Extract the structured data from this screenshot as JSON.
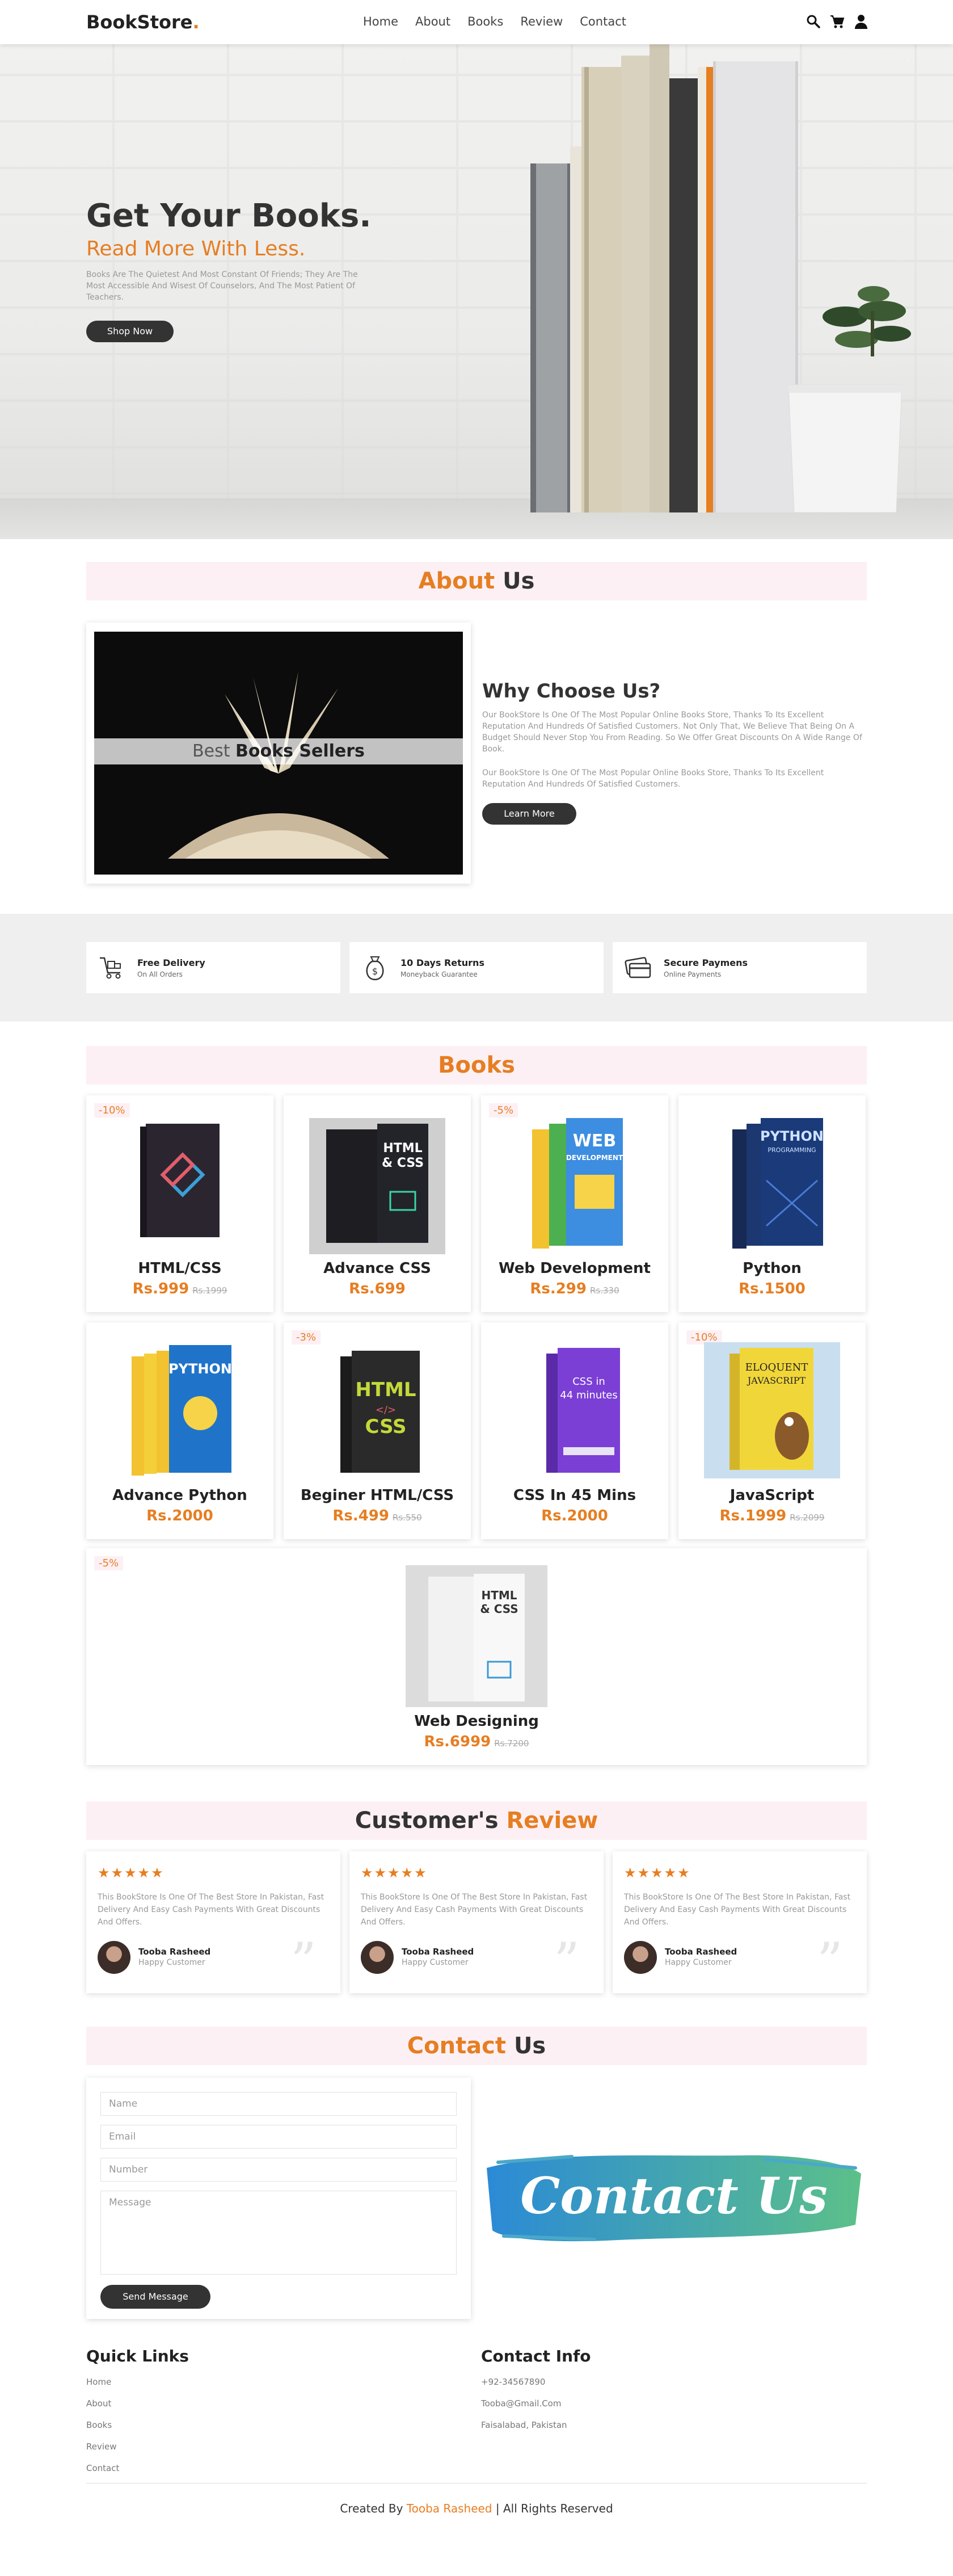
{
  "header": {
    "logo": "BookStore",
    "logo_dot": ".",
    "nav": [
      "Home",
      "About",
      "Books",
      "Review",
      "Contact"
    ],
    "icons": [
      "search-icon",
      "cart-icon",
      "user-icon"
    ]
  },
  "hero": {
    "title": "Get Your Books.",
    "subtitle": "Read More With Less.",
    "text": "Books Are The Quietest And Most Constant Of Friends; They Are The Most Accessible And Wisest Of Counselors, And The Most Patient Of Teachers.",
    "button": "Shop Now"
  },
  "about": {
    "title_accent": "About",
    "title_rest": " Us",
    "image_label_light": "Best ",
    "image_label_bold": "Books Sellers",
    "heading": "Why Choose Us?",
    "para1": "Our BookStore Is One Of The Most Popular Online Books Store, Thanks To Its Excellent Reputation And Hundreds Of Satisfied Customers. Not Only That, We Believe That Being On A Budget Should Never Stop You From Reading. So We Offer Great Discounts On A Wide Range Of Book.",
    "para2": "Our BookStore Is One Of The Most Popular Online Books Store, Thanks To Its Excellent Reputation And Hundreds Of Satisfied Customers.",
    "button": "Learn More"
  },
  "features": [
    {
      "icon": "delivery-cart-icon",
      "title": "Free Delivery",
      "sub": "On All Orders"
    },
    {
      "icon": "money-bag-icon",
      "title": "10 Days Returns",
      "sub": "Moneyback Guarantee"
    },
    {
      "icon": "credit-card-icon",
      "title": "Secure Paymens",
      "sub": "Online Payments"
    }
  ],
  "books_section": {
    "title": "Books"
  },
  "books": [
    {
      "name": "HTML/CSS",
      "price": "Rs.999",
      "old": "Rs.1999",
      "discount": "-10%"
    },
    {
      "name": "Advance CSS",
      "price": "Rs.699",
      "old": "",
      "discount": ""
    },
    {
      "name": "Web Development",
      "price": "Rs.299",
      "old": "Rs.330",
      "discount": "-5%"
    },
    {
      "name": "Python",
      "price": "Rs.1500",
      "old": "",
      "discount": ""
    },
    {
      "name": "Advance Python",
      "price": "Rs.2000",
      "old": "",
      "discount": ""
    },
    {
      "name": "Beginer HTML/CSS",
      "price": "Rs.499",
      "old": "Rs.550",
      "discount": "-3%"
    },
    {
      "name": "CSS In 45 Mins",
      "price": "Rs.2000",
      "old": "",
      "discount": ""
    },
    {
      "name": "JavaScript",
      "price": "Rs.1999",
      "old": "Rs.2099",
      "discount": "-10%"
    },
    {
      "name": "Web Designing",
      "price": "Rs.6999",
      "old": "Rs.7200",
      "discount": "-5%"
    }
  ],
  "reviews_section": {
    "title_rest": "Customer's ",
    "title_accent": "Review"
  },
  "reviews": [
    {
      "stars": "★★★★★",
      "text": "This BookStore Is One Of The Best Store In Pakistan, Fast Delivery And Easy Cash Payments With Great Discounts And Offers.",
      "name": "Tooba Rasheed",
      "role": "Happy Customer"
    },
    {
      "stars": "★★★★★",
      "text": "This BookStore Is One Of The Best Store In Pakistan, Fast Delivery And Easy Cash Payments With Great Discounts And Offers.",
      "name": "Tooba Rasheed",
      "role": "Happy Customer"
    },
    {
      "stars": "★★★★★",
      "text": "This BookStore Is One Of The Best Store In Pakistan, Fast Delivery And Easy Cash Payments With Great Discounts And Offers.",
      "name": "Tooba Rasheed",
      "role": "Happy Customer"
    }
  ],
  "contact": {
    "title_accent": "Contact",
    "title_rest": " Us",
    "name_placeholder": "Name",
    "email_placeholder": "Email",
    "number_placeholder": "Number",
    "message_placeholder": "Message",
    "button": "Send Message",
    "art_text": "Contact Us"
  },
  "footer": {
    "quick_title": "Quick Links",
    "quick_links": [
      "Home",
      "About",
      "Books",
      "Review",
      "Contact"
    ],
    "info_title": "Contact Info",
    "info": [
      "+92-34567890",
      "Tooba@Gmail.Com",
      "Faisalabad, Pakistan"
    ],
    "credit_prefix": "Created By ",
    "credit_name": "Tooba Rasheed",
    "credit_suffix": " | All Rights Reserved"
  },
  "colors": {
    "accent": "#e67e22",
    "dark": "#333333",
    "pink_band": "#fdf0f4"
  }
}
